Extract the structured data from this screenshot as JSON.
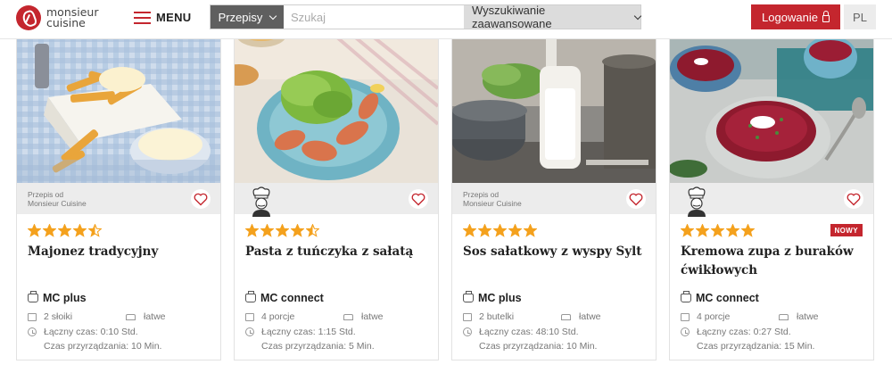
{
  "header": {
    "logo_line1": "monsieur",
    "logo_line2": "cuisine",
    "menu_label": "MENU",
    "recipes_label": "Przepisy",
    "search_placeholder": "Szukaj",
    "advanced_search_label": "Wyszukiwanie zaawansowane",
    "login_label": "Logowanie",
    "language": "PL"
  },
  "colors": {
    "brand": "#c4262e",
    "star": "#f4a11d"
  },
  "cards": [
    {
      "from_label_1": "Przepis od",
      "from_label_2": "Monsieur Cuisine",
      "rating": 4.5,
      "title": "Majonez tradycyjny",
      "machine": "MC plus",
      "portions": "2 słoiki",
      "difficulty": "łatwe",
      "total_time": "Łączny czas: 0:10 Std.",
      "prep_time": "Czas przyrządzania: 10 Min.",
      "badge": ""
    },
    {
      "from_label_1": "",
      "from_label_2": "",
      "rating": 4.5,
      "title": "Pasta z tuńczyka z sałatą",
      "machine": "MC connect",
      "portions": "4 porcje",
      "difficulty": "łatwe",
      "total_time": "Łączny czas: 1:15 Std.",
      "prep_time": "Czas przyrządzania: 5 Min.",
      "badge": ""
    },
    {
      "from_label_1": "Przepis od",
      "from_label_2": "Monsieur Cuisine",
      "rating": 5,
      "title": "Sos sałatkowy z wyspy Sylt",
      "machine": "MC plus",
      "portions": "2 butelki",
      "difficulty": "łatwe",
      "total_time": "Łączny czas: 48:10 Std.",
      "prep_time": "Czas przyrządzania: 10 Min.",
      "badge": ""
    },
    {
      "from_label_1": "",
      "from_label_2": "",
      "rating": 5,
      "title": "Kremowa zupa z buraków ćwikłowych",
      "machine": "MC connect",
      "portions": "4 porcje",
      "difficulty": "łatwe",
      "total_time": "Łączny czas: 0:27 Std.",
      "prep_time": "Czas przyrządzania: 15 Min.",
      "badge": "NOWY"
    }
  ]
}
